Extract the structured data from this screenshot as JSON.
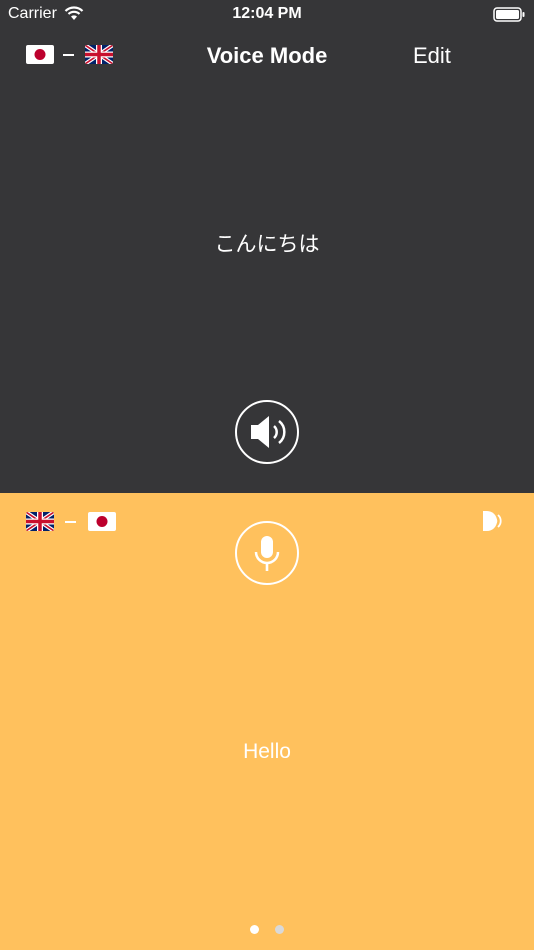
{
  "status_bar": {
    "carrier": "Carrier",
    "time": "12:04 PM"
  },
  "nav": {
    "title": "Voice Mode",
    "edit_label": "Edit"
  },
  "top_pane": {
    "source_flag": "japan-flag",
    "target_flag": "uk-flag",
    "phrase": "こんにちは",
    "action_icon": "speaker-icon",
    "background": "#363638"
  },
  "bottom_pane": {
    "source_flag": "uk-flag",
    "target_flag": "japan-flag",
    "phrase": "Hello",
    "action_icon": "microphone-icon",
    "corner_icon": "speak-toggle-icon",
    "background": "#FFC15D"
  },
  "page_indicator": {
    "count": 2,
    "active_index": 0,
    "active_color": "#FFFFFF",
    "inactive_color": "#D9D9D9"
  }
}
